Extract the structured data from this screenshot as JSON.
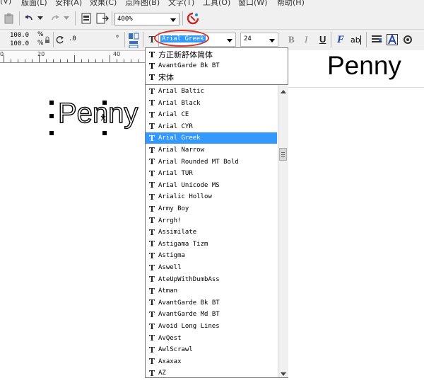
{
  "menu": {
    "items": [
      "(V)",
      "版面(L)",
      "安排(A)",
      "效果(C)",
      "点阵图(B)",
      "文字(T)",
      "工具(O)",
      "窗口(W)",
      "帮助(H)"
    ]
  },
  "toolbar": {
    "zoom_value": "400%",
    "width_value": "100.0",
    "height_value": "100.0",
    "percent_top": "%",
    "percent_bottom": "%",
    "rotation_value": ".0",
    "degree_symbol": "°",
    "font_name": "Arial Greek",
    "font_size": "24",
    "bold_label": "B",
    "italic_label": "I",
    "underline_label": "U",
    "script_label": "ab"
  },
  "ruler": {
    "labels": [
      "0",
      "20",
      "40"
    ]
  },
  "canvas": {
    "selected_text": "Penny",
    "preview_text": "Penny"
  },
  "font_list": {
    "recent": [
      "方正新舒体简体",
      "AvantGarde Bk BT",
      "宋体"
    ],
    "items": [
      "Arial Baltic",
      "Arial Black",
      "Arial CE",
      "Arial CYR",
      "Arial Greek",
      "Arial Narrow",
      "Arial Rounded MT Bold",
      "Arial TUR",
      "Arial Unicode MS",
      "Arialic Hollow",
      "Army Boy",
      "Arrgh!",
      "Assimilate",
      "Astigama Tizm",
      "Astigma",
      "Aswell",
      "AteUpWithDumbAss",
      "Atman",
      "AvantGarde Bk BT",
      "AvantGarde Md BT",
      "Avoid Long Lines",
      "AvQest",
      "AwlScrawl",
      "Axaxax",
      "AZ"
    ],
    "selected": "Arial Greek"
  },
  "colors": {
    "selection_blue": "#3399ff",
    "highlight_red": "#d93025",
    "toolbar_bg": "#f0f0f0"
  }
}
